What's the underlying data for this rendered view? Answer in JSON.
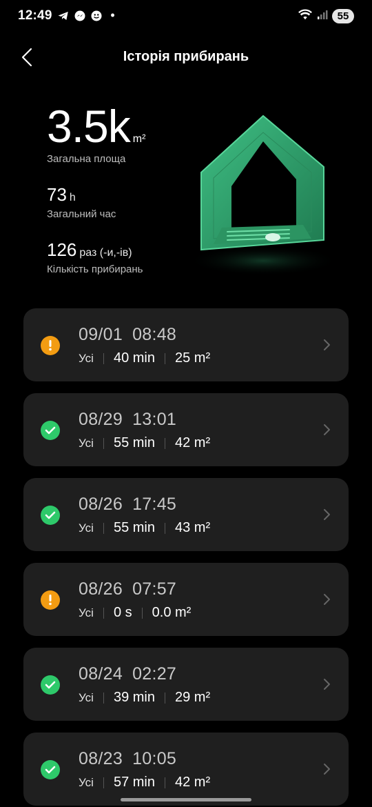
{
  "status_bar": {
    "time": "12:49",
    "dot": "•",
    "battery": "55",
    "icons": [
      "telegram-icon",
      "messenger-icon",
      "emoji-icon",
      "wifi-icon",
      "signal-icon"
    ]
  },
  "header": {
    "title": "Історія прибирань"
  },
  "summary": {
    "total_area_value": "3.5k",
    "total_area_unit": "m²",
    "total_area_label": "Загальна площа",
    "total_time_value": "73",
    "total_time_unit": "h",
    "total_time_label": "Загальний час",
    "count_value": "126",
    "count_unit": "раз (-и,-ів)",
    "count_label": "Кількість прибирань"
  },
  "history": [
    {
      "date": "09/01",
      "time": "08:48",
      "status": "warning",
      "mode": "Усі",
      "duration": "40 min",
      "area": "25 m²"
    },
    {
      "date": "08/29",
      "time": "13:01",
      "status": "success",
      "mode": "Усі",
      "duration": "55 min",
      "area": "42 m²"
    },
    {
      "date": "08/26",
      "time": "17:45",
      "status": "success",
      "mode": "Усі",
      "duration": "55 min",
      "area": "43 m²"
    },
    {
      "date": "08/26",
      "time": "07:57",
      "status": "warning",
      "mode": "Усі",
      "duration": "0 s",
      "area": "0.0 m²"
    },
    {
      "date": "08/24",
      "time": "02:27",
      "status": "success",
      "mode": "Усі",
      "duration": "39 min",
      "area": "29 m²"
    },
    {
      "date": "08/23",
      "time": "10:05",
      "status": "success",
      "mode": "Усі",
      "duration": "57 min",
      "area": "42 m²"
    }
  ],
  "colors": {
    "background": "#000000",
    "card": "#1f1f1f",
    "warning": "#f39c12",
    "success": "#2ec96a",
    "house": "#2f9e6a"
  }
}
